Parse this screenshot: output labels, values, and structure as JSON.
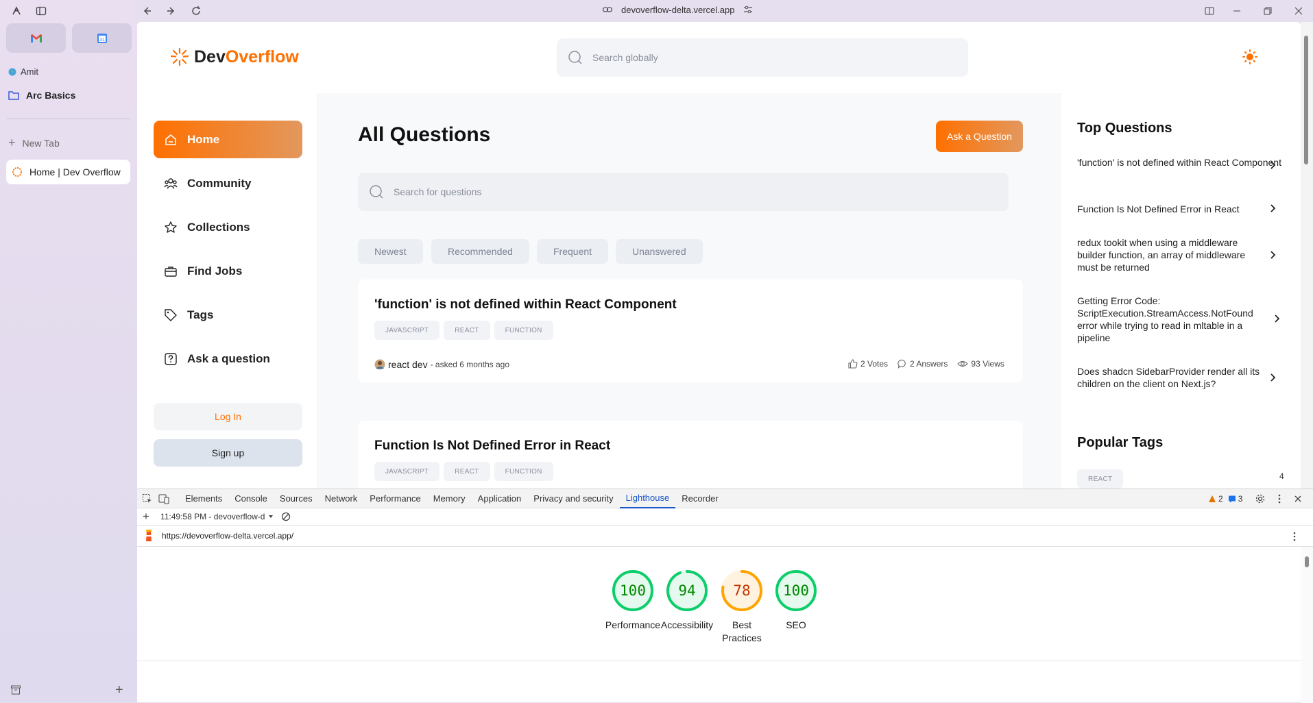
{
  "arc": {
    "space_name": "Amit",
    "folder_label": "Arc Basics",
    "new_tab_label": "New Tab",
    "active_tab_label": "Home | Dev Overflow",
    "pinned": [
      "gmail-icon",
      "calendar-icon"
    ]
  },
  "browser": {
    "url": "devoverflow-delta.vercel.app"
  },
  "site": {
    "logo_dev": "Dev",
    "logo_overflow": "Overflow",
    "global_search_placeholder": "Search globally",
    "nav": [
      {
        "label": "Home",
        "icon": "home-icon"
      },
      {
        "label": "Community",
        "icon": "users-icon"
      },
      {
        "label": "Collections",
        "icon": "star-icon"
      },
      {
        "label": "Find Jobs",
        "icon": "briefcase-icon"
      },
      {
        "label": "Tags",
        "icon": "tag-icon"
      },
      {
        "label": "Ask a question",
        "icon": "question-icon"
      }
    ],
    "login_label": "Log In",
    "signup_label": "Sign up",
    "page_title": "All Questions",
    "ask_button": "Ask a Question",
    "question_search_placeholder": "Search for questions",
    "filters": [
      "Newest",
      "Recommended",
      "Frequent",
      "Unanswered"
    ],
    "questions": [
      {
        "title": "'function' is not defined within React Component",
        "tags": [
          "JAVASCRIPT",
          "REACT",
          "FUNCTION"
        ],
        "author": "react dev",
        "asked": "- asked 6 months ago",
        "votes": "2 Votes",
        "answers": "2 Answers",
        "views": "93 Views"
      },
      {
        "title": "Function Is Not Defined Error in React",
        "tags": [
          "JAVASCRIPT",
          "REACT",
          "FUNCTION"
        ]
      }
    ],
    "top_questions_title": "Top Questions",
    "top_questions": [
      "'function' is not defined within React Component",
      "Function Is Not Defined Error in React",
      "redux tookit when using a middleware builder function, an array of middleware must be returned",
      "Getting Error Code: ScriptExecution.StreamAccess.NotFound error while trying to read in mltable in a pipeline",
      "Does shadcn SidebarProvider render all its children on the client on Next.js?"
    ],
    "popular_tags_title": "Popular Tags",
    "popular_tags": [
      {
        "name": "REACT",
        "count": "4"
      }
    ]
  },
  "devtools": {
    "tabs": [
      "Elements",
      "Console",
      "Sources",
      "Network",
      "Performance",
      "Memory",
      "Application",
      "Privacy and security",
      "Lighthouse",
      "Recorder"
    ],
    "active_tab": "Lighthouse",
    "warnings": "2",
    "messages": "3",
    "report_label": "11:49:58 PM - devoverflow-d",
    "report_url": "https://devoverflow-delta.vercel.app/",
    "scores": [
      {
        "label": "Performance",
        "value": "100",
        "fraction": 1.0,
        "color": "#0cce6b"
      },
      {
        "label": "Accessibility",
        "value": "94",
        "fraction": 0.94,
        "color": "#0cce6b"
      },
      {
        "label": "Best Practices",
        "value": "78",
        "fraction": 0.78,
        "color": "#ffa400"
      },
      {
        "label": "SEO",
        "value": "100",
        "fraction": 1.0,
        "color": "#0cce6b"
      }
    ]
  },
  "colors": {
    "accent": "#ff7000",
    "pass": "#0cce6b",
    "average": "#ffa400",
    "devtools_active": "#1a56c9"
  }
}
